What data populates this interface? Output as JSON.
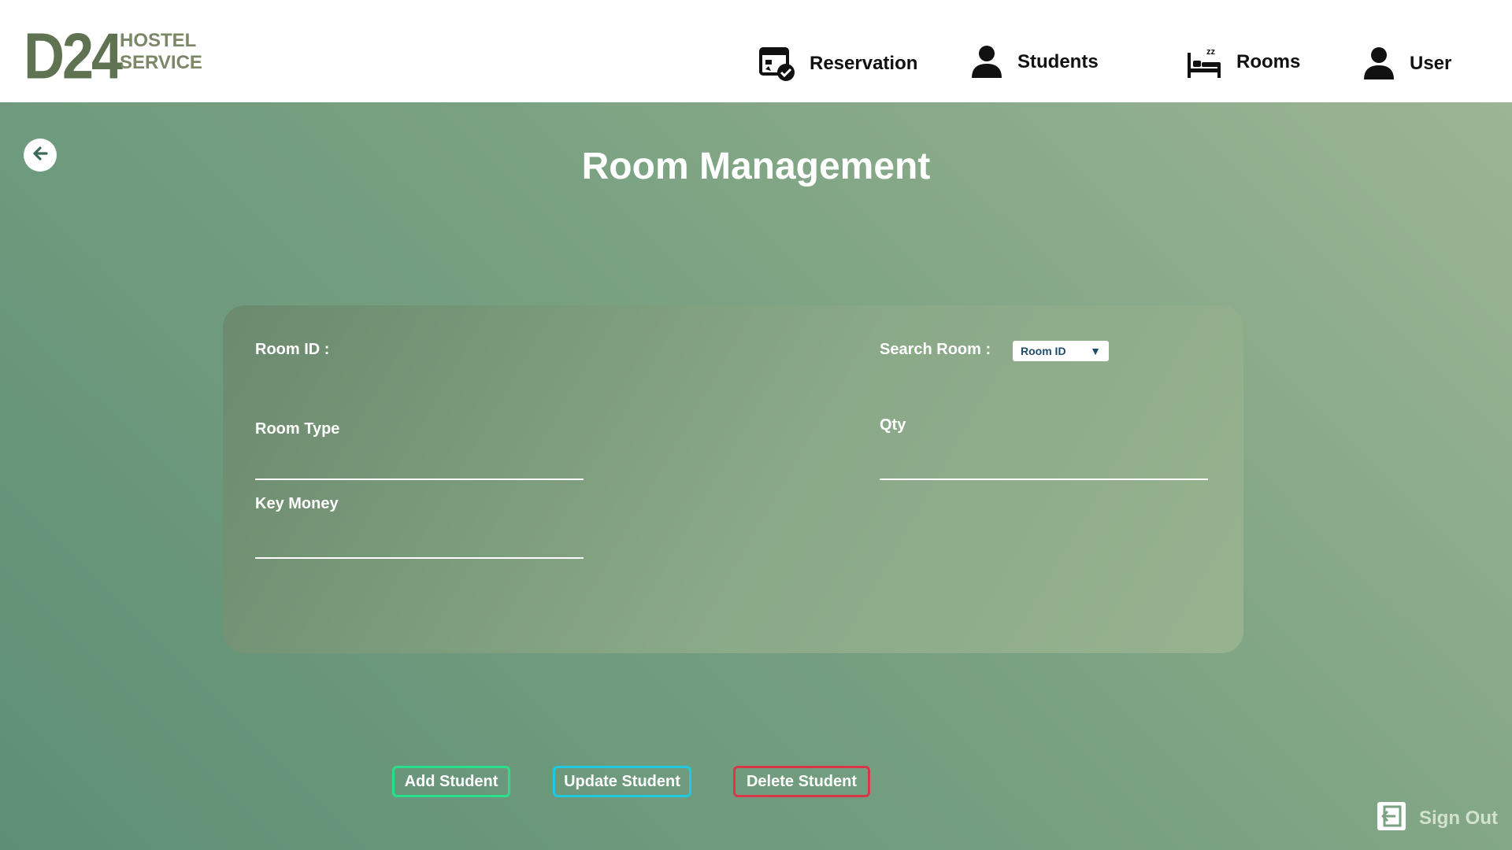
{
  "brand": {
    "mark": "D24",
    "line1": "HOSTEL",
    "line2": "SERVICE"
  },
  "nav": [
    {
      "label": "Reservation",
      "icon": "reservation-icon"
    },
    {
      "label": "Students",
      "icon": "person-icon"
    },
    {
      "label": "Rooms",
      "icon": "bed-icon"
    },
    {
      "label": "User",
      "icon": "person-icon"
    }
  ],
  "page": {
    "title": "Room Management"
  },
  "form": {
    "room_id_label": "Room ID :",
    "room_type_label": "Room Type",
    "key_money_label": "Key Money",
    "qty_label": "Qty",
    "search_label": "Search Room :",
    "search_selected": "Room ID"
  },
  "actions": {
    "add": "Add Student",
    "update": "Update Student",
    "delete": "Delete Student"
  },
  "signout": {
    "label": "Sign Out"
  },
  "colors": {
    "add_border": "#29e08a",
    "update_border": "#1fc9e0",
    "delete_border": "#d9364a"
  }
}
